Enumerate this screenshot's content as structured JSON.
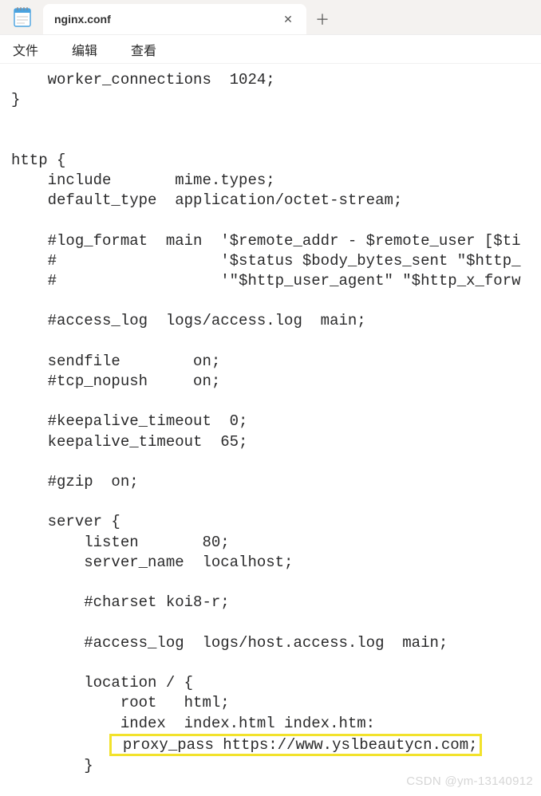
{
  "tab": {
    "title": "nginx.conf",
    "close_glyph": "✕",
    "new_tab_glyph": "＋"
  },
  "menu": {
    "file": "文件",
    "edit": "编辑",
    "view": "查看"
  },
  "code": {
    "l1": "    worker_connections  1024;",
    "l2": "}",
    "l3": "",
    "l4": "",
    "l5": "http {",
    "l6": "    include       mime.types;",
    "l7": "    default_type  application/octet-stream;",
    "l8": "",
    "l9": "    #log_format  main  '$remote_addr - $remote_user [$ti",
    "l10": "    #                  '$status $body_bytes_sent \"$http_",
    "l11": "    #                  '\"$http_user_agent\" \"$http_x_forw",
    "l12": "",
    "l13": "    #access_log  logs/access.log  main;",
    "l14": "",
    "l15": "    sendfile        on;",
    "l16": "    #tcp_nopush     on;",
    "l17": "",
    "l18": "    #keepalive_timeout  0;",
    "l19": "    keepalive_timeout  65;",
    "l20": "",
    "l21": "    #gzip  on;",
    "l22": "",
    "l23": "    server {",
    "l24": "        listen       80;",
    "l25": "        server_name  localhost;",
    "l26": "",
    "l27": "        #charset koi8-r;",
    "l28": "",
    "l29": "        #access_log  logs/host.access.log  main;",
    "l30": "",
    "l31": "        location / {",
    "l32": "            root   html;",
    "l33": "            index  index.html index.htm:",
    "l34_prefix": "           ",
    "l34_highlight": " proxy_pass https://www.yslbeautycn.com;",
    "l35": "        }"
  },
  "watermark": "CSDN @ym-13140912"
}
